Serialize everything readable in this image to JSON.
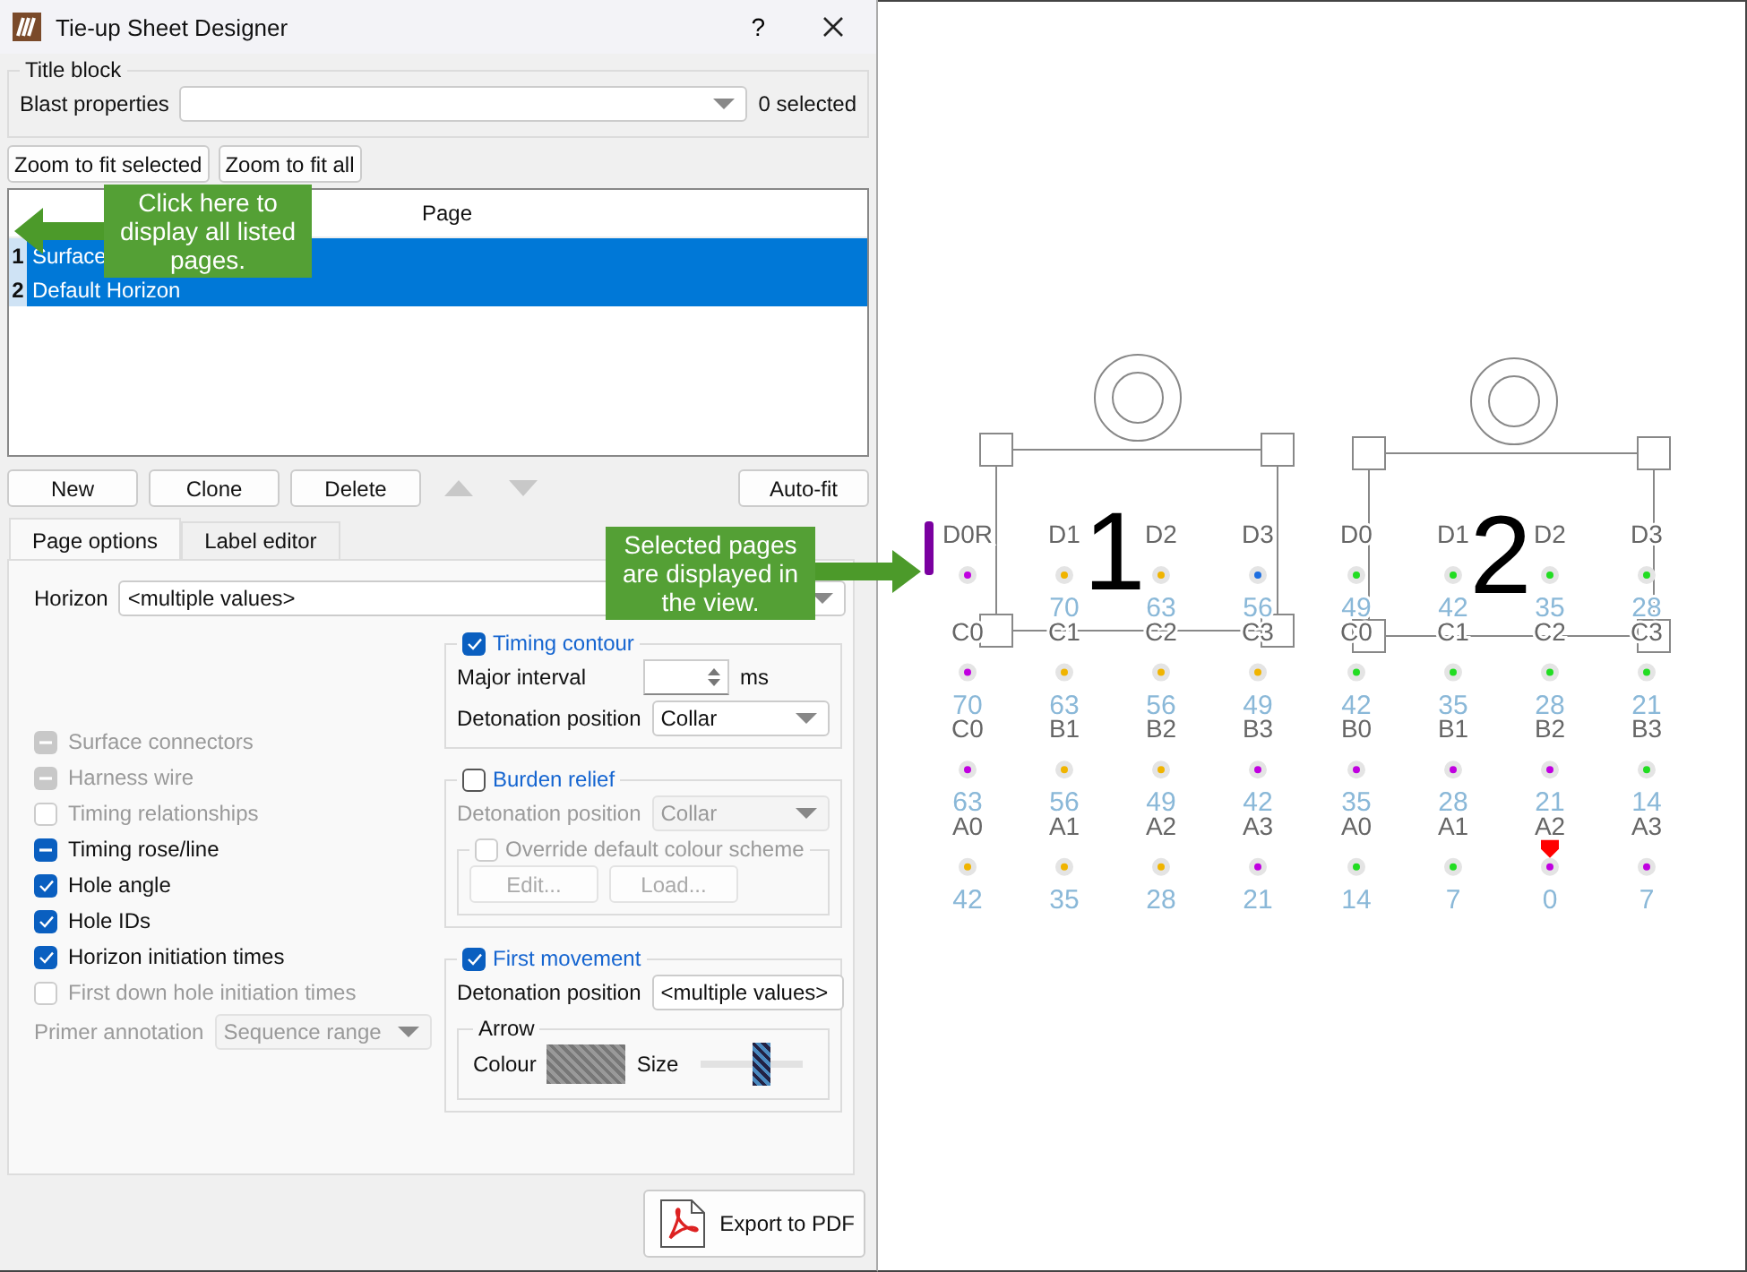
{
  "window": {
    "title": "Tie-up Sheet Designer",
    "help": "?"
  },
  "title_block": {
    "label": "Title block",
    "blast_label": "Blast properties",
    "selection_count": "0 selected"
  },
  "zoom_buttons": [
    "Zoom to fit selected",
    "Zoom to fit all"
  ],
  "page_table": {
    "column": "Page",
    "rows": [
      {
        "index": "1",
        "name": "Surface",
        "selected": true
      },
      {
        "index": "2",
        "name": "Default Horizon",
        "selected": true
      }
    ]
  },
  "page_buttons": [
    "New",
    "Clone",
    "Delete"
  ],
  "autofit_button": "Auto-fit",
  "tabs": [
    {
      "label": "Page options",
      "selected": true
    },
    {
      "label": "Label editor",
      "selected": false
    }
  ],
  "page_options": {
    "horizon_label": "Horizon",
    "horizon_value": "<multiple values>",
    "checkboxes": [
      {
        "label": "Surface connectors",
        "checked": true,
        "partial": true,
        "disabled": true
      },
      {
        "label": "Harness wire",
        "checked": true,
        "partial": true,
        "disabled": true
      },
      {
        "label": "Timing relationships",
        "checked": false,
        "partial": false,
        "disabled": true
      },
      {
        "label": "Timing rose/line",
        "checked": true,
        "partial": true,
        "disabled": false
      },
      {
        "label": "Hole angle",
        "checked": true,
        "partial": false,
        "disabled": false
      },
      {
        "label": "Hole IDs",
        "checked": true,
        "partial": false,
        "disabled": false
      },
      {
        "label": "Horizon initiation times",
        "checked": true,
        "partial": false,
        "disabled": false
      },
      {
        "label": "First down hole initiation times",
        "checked": false,
        "partial": false,
        "disabled": true
      }
    ],
    "primer": {
      "label": "Primer annotation",
      "value": "Sequence range",
      "disabled": true
    },
    "timing_contour": {
      "label": "Timing contour",
      "checked": true,
      "interval_label": "Major interval",
      "unit": "ms",
      "position_label": "Detonation position",
      "position_value": "Collar"
    },
    "burden_relief": {
      "label": "Burden relief",
      "checked": false,
      "position_label": "Detonation position",
      "position_value": "Collar",
      "override": {
        "label": "Override default colour scheme",
        "checked": false
      },
      "buttons": [
        "Edit...",
        "Load..."
      ]
    },
    "first_movement": {
      "label": "First movement",
      "checked": true,
      "position_label": "Detonation position",
      "position_value": "<multiple values>",
      "arrow": {
        "label": "Arrow",
        "colour_label": "Colour",
        "size": {
          "label": "Size",
          "level": 0.6
        }
      }
    }
  },
  "export_button": "Export to PDF",
  "callouts": [
    {
      "text": "Click here to display all listed pages.",
      "kind": "left"
    },
    {
      "text": "Selected pages are displayed in the view.",
      "kind": "right"
    }
  ],
  "view": {
    "pages": [
      {
        "number": "1"
      },
      {
        "number": "2"
      }
    ],
    "hole_grids": [
      {
        "rows": [
          [
            {
              "kind": "angle",
              "label": "D0R",
              "color": "#c000e0"
            },
            {
              "kind": "plain",
              "label": "D1",
              "color": "#f0b400",
              "time": "70"
            },
            {
              "kind": "plain",
              "label": "D2",
              "color": "#f0b400",
              "time": "63"
            },
            {
              "kind": "plain",
              "label": "D3",
              "color": "#1e6fe0",
              "time": "56"
            }
          ],
          [
            {
              "kind": "plain",
              "label": "C0",
              "color": "#c000e0",
              "time": "70"
            },
            {
              "kind": "plain",
              "label": "C1",
              "color": "#f0b400",
              "time": "63"
            },
            {
              "kind": "plain",
              "label": "C2",
              "color": "#f0b400",
              "time": "56"
            },
            {
              "kind": "plain",
              "label": "C3",
              "color": "#f0b400",
              "time": "49"
            }
          ],
          [
            {
              "kind": "plain",
              "label": "C0",
              "color": "#c000e0",
              "time": "63"
            },
            {
              "kind": "plain",
              "label": "B1",
              "color": "#f0b400",
              "time": "56"
            },
            {
              "kind": "plain",
              "label": "B2",
              "color": "#f0b400",
              "time": "49"
            },
            {
              "kind": "plain",
              "label": "B3",
              "color": "#c000e0",
              "time": "42"
            }
          ],
          [
            {
              "kind": "plain",
              "label": "A0",
              "color": "#f0b400",
              "time": "42"
            },
            {
              "kind": "plain",
              "label": "A1",
              "color": "#f0b400",
              "time": "35"
            },
            {
              "kind": "plain",
              "label": "A2",
              "color": "#f0b400",
              "time": "28"
            },
            {
              "kind": "plain",
              "label": "A3",
              "color": "#c000e0",
              "time": "21"
            }
          ]
        ]
      },
      {
        "rows": [
          [
            {
              "kind": "plain",
              "label": "D0",
              "color": "#22dd22",
              "time": "49"
            },
            {
              "kind": "plain",
              "label": "D1",
              "color": "#22dd22",
              "time": "42"
            },
            {
              "kind": "plain",
              "label": "D2",
              "color": "#22dd22",
              "time": "35"
            },
            {
              "kind": "plain",
              "label": "D3",
              "color": "#22dd22",
              "time": "28"
            }
          ],
          [
            {
              "kind": "plain",
              "label": "C0",
              "color": "#22dd22",
              "time": "42"
            },
            {
              "kind": "plain",
              "label": "C1",
              "color": "#22dd22",
              "time": "35"
            },
            {
              "kind": "plain",
              "label": "C2",
              "color": "#22dd22",
              "time": "28"
            },
            {
              "kind": "plain",
              "label": "C3",
              "color": "#22dd22",
              "time": "21"
            }
          ],
          [
            {
              "kind": "plain",
              "label": "B0",
              "color": "#c000e0",
              "time": "35"
            },
            {
              "kind": "plain",
              "label": "B1",
              "color": "#c000e0",
              "time": "28"
            },
            {
              "kind": "plain",
              "label": "B2",
              "color": "#c000e0",
              "time": "21"
            },
            {
              "kind": "plain",
              "label": "B3",
              "color": "#22dd22",
              "time": "14"
            }
          ],
          [
            {
              "kind": "plain",
              "label": "A0",
              "color": "#22dd22",
              "time": "14"
            },
            {
              "kind": "plain",
              "label": "A1",
              "color": "#22dd22",
              "time": "7"
            },
            {
              "kind": "arrow",
              "label": "A2",
              "color": "#c000e0",
              "time": "0"
            },
            {
              "kind": "plain",
              "label": "A3",
              "color": "#c000e0",
              "time": "7"
            }
          ]
        ]
      }
    ]
  }
}
